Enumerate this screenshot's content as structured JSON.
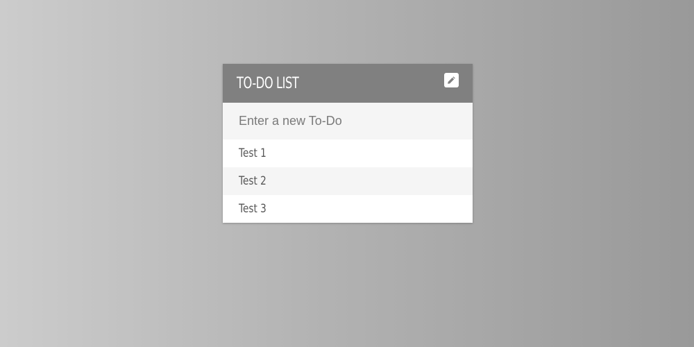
{
  "todo": {
    "title": "TO-DO LIST",
    "edit_icon": "pencil-icon",
    "input_placeholder": "Enter a new To-Do",
    "input_value": "",
    "items": [
      {
        "label": "Test 1"
      },
      {
        "label": "Test 2"
      },
      {
        "label": "Test 3"
      }
    ]
  },
  "colors": {
    "header_bg": "#808080",
    "header_text": "#ffffff",
    "input_bg": "#f5f5f5",
    "item_text": "#555555"
  }
}
